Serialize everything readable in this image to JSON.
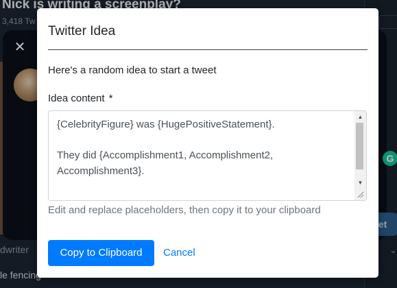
{
  "background": {
    "page_title": "Nick is writing a screenplay?",
    "tweet_count": "3,418 Tw",
    "handle": "dwriter",
    "tweet_snippet": "le fencing",
    "tweet_button_label": "eet",
    "close_symbol": "✕",
    "grammarly_letter": "G",
    "chevron_symbol": "⌄"
  },
  "modal": {
    "title": "Twitter Idea",
    "description": "Here's a random idea to start a tweet",
    "field_label": "Idea content",
    "required_marker": "*",
    "idea_content": "{CelebrityFigure} was {HugePositiveStatement}.\n\nThey did {Accomplishment1, Accomplishment2, Accomplishment3}.",
    "help_text": "Edit and replace placeholders, then copy it to your clipboard",
    "copy_button_label": "Copy to Clipboard",
    "cancel_button_label": "Cancel"
  },
  "colors": {
    "primary": "#007bff",
    "overlay_bg": "#15202b",
    "muted_text": "#6c757d"
  }
}
